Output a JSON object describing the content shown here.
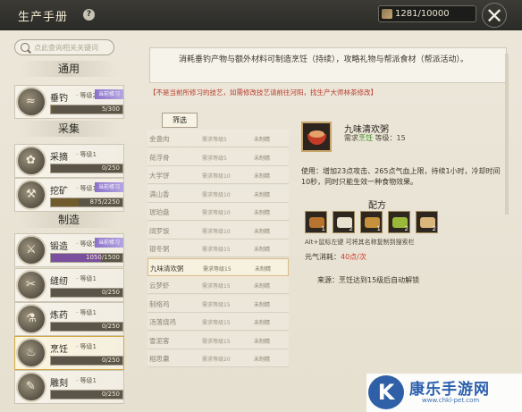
{
  "window": {
    "title": "生产手册",
    "help": "?",
    "counter": "1281/10000",
    "close": "✕"
  },
  "search": {
    "placeholder": "点此查询相关关键词"
  },
  "sections": [
    {
      "label": "通用"
    },
    {
      "label": "采集"
    },
    {
      "label": "制造"
    }
  ],
  "skills": [
    {
      "name": "垂钓",
      "level": "等级2",
      "tag": "当前修习",
      "progress": "5/300",
      "fill_pct": 2,
      "color": "#6f5b2c",
      "icon": "fishing-icon",
      "glyph": "≈"
    },
    {
      "name": "采摘",
      "level": "等级1",
      "tag": "",
      "progress": "0/250",
      "fill_pct": 0,
      "color": "#6f5b2c",
      "icon": "herb-icon",
      "glyph": "✿"
    },
    {
      "name": "挖矿",
      "level": "等级12",
      "tag": "当前修习",
      "progress": "875/2250",
      "fill_pct": 39,
      "color": "#6f5b2c",
      "icon": "pickaxe-icon",
      "glyph": "⚒"
    },
    {
      "name": "锻造",
      "level": "等级5",
      "tag": "当前修习",
      "progress": "1050/1500",
      "fill_pct": 70,
      "color": "#7a4f9e",
      "icon": "anvil-icon",
      "glyph": "⚔"
    },
    {
      "name": "缝纫",
      "level": "等级1",
      "tag": "",
      "progress": "0/250",
      "fill_pct": 0,
      "color": "#6f5b2c",
      "icon": "needle-icon",
      "glyph": "✂"
    },
    {
      "name": "炼药",
      "level": "等级1",
      "tag": "",
      "progress": "0/250",
      "fill_pct": 0,
      "color": "#6f5b2c",
      "icon": "potion-icon",
      "glyph": "⚗"
    },
    {
      "name": "烹饪",
      "level": "等级1",
      "tag": "",
      "progress": "0/250",
      "fill_pct": 0,
      "color": "#6f5b2c",
      "icon": "cooking-icon",
      "glyph": "♨"
    },
    {
      "name": "雕刻",
      "level": "等级1",
      "tag": "",
      "progress": "0/250",
      "fill_pct": 0,
      "color": "#6f5b2c",
      "icon": "carving-icon",
      "glyph": "✎"
    }
  ],
  "notice": "消耗垂钓产物与额外材料可制造烹饪（持续），攻略礼物与帮派食材（帮派活动）。",
  "warning": "【不是当前所修习的技艺，如需修改技艺请前往河阳，找生产大师林茶修改】",
  "filter": "筛选",
  "recipes": [
    {
      "name": "金盏肉",
      "req": "需求等级5",
      "status": "未制精"
    },
    {
      "name": "荷浮骨",
      "req": "需求等级5",
      "status": "未制精"
    },
    {
      "name": "大学饼",
      "req": "需求等级10",
      "status": "未制精"
    },
    {
      "name": "满山香",
      "req": "需求等级10",
      "status": "未制精"
    },
    {
      "name": "琥珀盘",
      "req": "需求等级10",
      "status": "未制精"
    },
    {
      "name": "阔罗饭",
      "req": "需求等级10",
      "status": "未制精"
    },
    {
      "name": "银冬粥",
      "req": "需求等级15",
      "status": "未制精"
    },
    {
      "name": "九味清欢粥",
      "req": "需求等级15",
      "status": "未制精"
    },
    {
      "name": "云梦虾",
      "req": "需求等级15",
      "status": "未制精"
    },
    {
      "name": "制络鸡",
      "req": "需求等级15",
      "status": "未制精"
    },
    {
      "name": "汤落烧鸡",
      "req": "需求等级15",
      "status": "未制精"
    },
    {
      "name": "雪泥客",
      "req": "需求等级15",
      "status": "未制精"
    },
    {
      "name": "相思羹",
      "req": "需求等级20",
      "status": "未制精"
    }
  ],
  "detail": {
    "name": "九味清欢粥",
    "req_prefix": "需求",
    "req_skill": "烹饪",
    "req_level": "等级：15",
    "desc": "使用：增加23点攻击、265点气血上限，持续1小时，冷却时间10秒，同时只能生效一种食物效果。",
    "recipe_title": "配方",
    "materials": [
      {
        "name": "meat-icon",
        "count": "1",
        "color": "#b8742f"
      },
      {
        "name": "rice-icon",
        "count": "2",
        "color": "#e8e1cf"
      },
      {
        "name": "tofu-icon",
        "count": "1",
        "color": "#c6903c"
      },
      {
        "name": "corn-icon",
        "count": "2",
        "color": "#9ab83a"
      },
      {
        "name": "dough-icon",
        "count": "2",
        "color": "#d9b67c"
      }
    ],
    "alt_hint": "Alt+鼠标左键 可将其名称复制到搜索栏",
    "cost_label": "元气消耗：",
    "cost_value": "40点/次",
    "source": "来源：烹饪达到15级后自动解锁"
  },
  "logo": {
    "badge": "K",
    "text": "康乐手游网",
    "url": "www.chkl-pet.com"
  }
}
